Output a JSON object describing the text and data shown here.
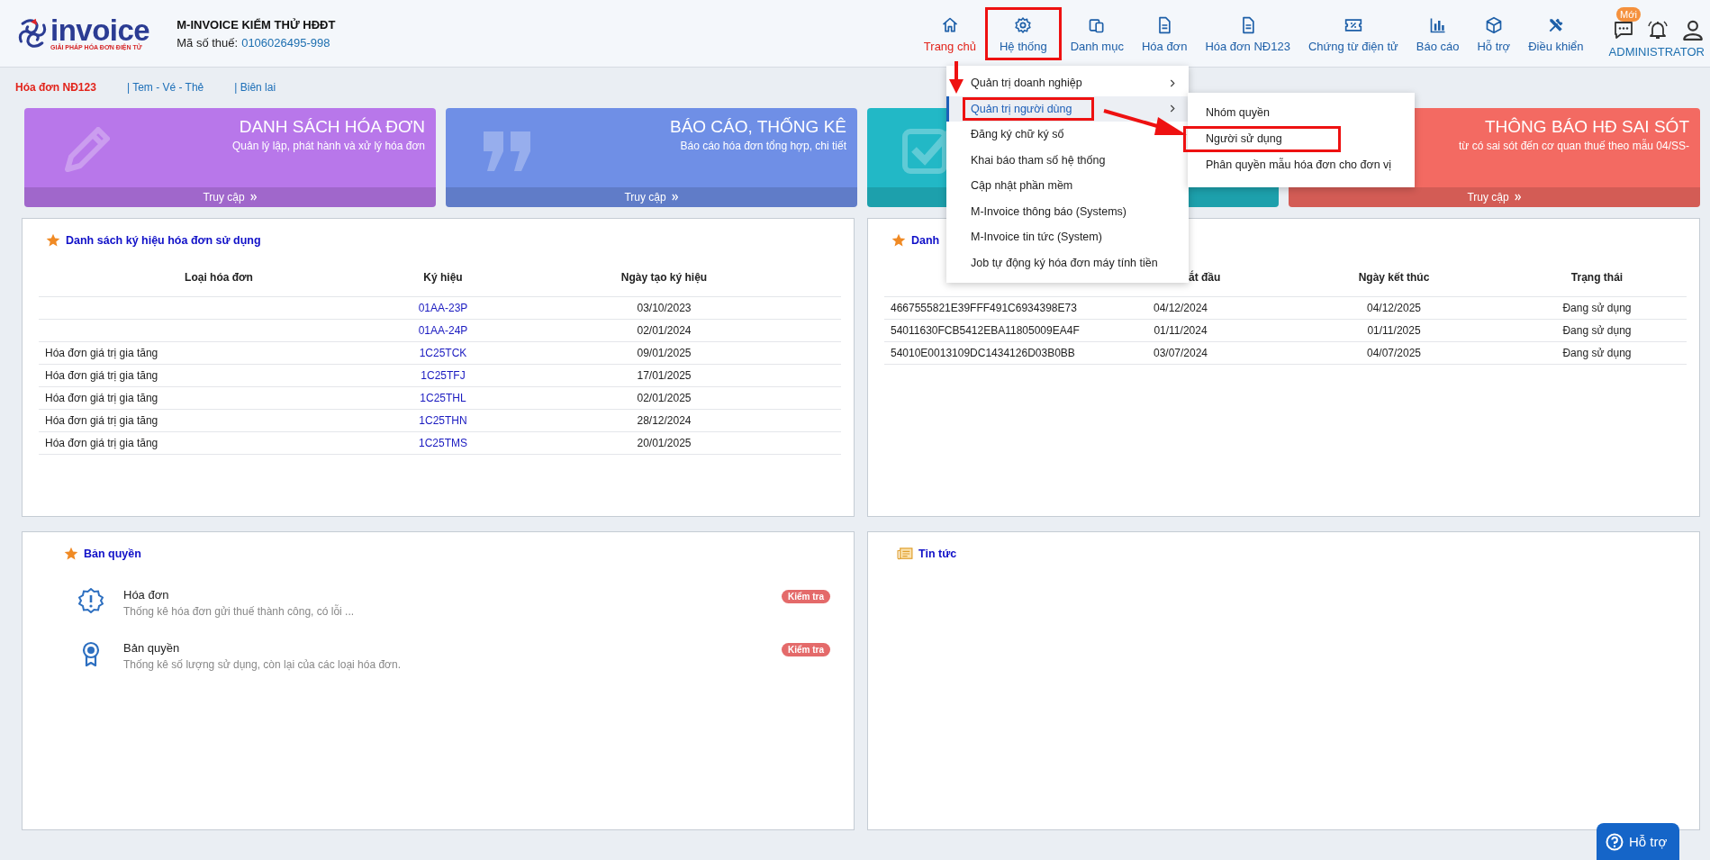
{
  "header": {
    "logo_text": "invoice",
    "logo_tagline": "GIẢI PHÁP HÓA ĐƠN ĐIỆN TỬ",
    "company": "M-INVOICE KIỂM THỬ HĐĐT",
    "tax_label": "Mã số thuế:",
    "tax_code": "0106026495-998"
  },
  "nav": [
    {
      "label": "Trang chủ",
      "selected": true,
      "annotated": false
    },
    {
      "label": "Hệ thống",
      "selected": false,
      "annotated": true
    },
    {
      "label": "Danh mục",
      "selected": false,
      "annotated": false
    },
    {
      "label": "Hóa đơn",
      "selected": false,
      "annotated": false
    },
    {
      "label": "Hóa đơn NĐ123",
      "selected": false,
      "annotated": false
    },
    {
      "label": "Chứng từ điện tử",
      "selected": false,
      "annotated": false
    },
    {
      "label": "Báo cáo",
      "selected": false,
      "annotated": false
    },
    {
      "label": "Hỗ trợ",
      "selected": false,
      "annotated": false
    },
    {
      "label": "Điều khiển",
      "selected": false,
      "annotated": false
    }
  ],
  "user": {
    "badge": "Mới",
    "name": "ADMINISTRATOR"
  },
  "sub_tabs": [
    {
      "label": "Hóa đơn NĐ123",
      "selected": true
    },
    {
      "label": "| Tem - Vé - Thẻ",
      "selected": false
    },
    {
      "label": "| Biên lai",
      "selected": false
    }
  ],
  "banners": [
    {
      "title": "DANH SÁCH HÓA ĐƠN",
      "subtitle": "Quản lý lập, phát hành và xử lý hóa đơn",
      "link": "Truy cập",
      "color": "#b877ea"
    },
    {
      "title": "BÁO CÁO, THỐNG KÊ",
      "subtitle": "Báo cáo hóa đơn tổng hợp, chi tiết",
      "link": "Truy cập",
      "color": "#6f8fe6"
    },
    {
      "color": "#22b8c6"
    },
    {
      "title": "THÔNG BÁO HĐ SAI SÓT",
      "subtitle": "từ có sai sót đến cơ quan thuế theo mẫu 04/SS-",
      "link": "Truy cập",
      "color": "#f36a62"
    }
  ],
  "symbol_panel": {
    "title": "Danh sách ký hiệu hóa đơn sử dụng",
    "columns": [
      "Loại hóa đơn",
      "Ký hiệu",
      "Ngày tạo ký hiệu"
    ],
    "rows": [
      {
        "symbol": "01AA-23P",
        "date": "03/10/2023"
      },
      {
        "symbol": "01AA-24P",
        "date": "02/01/2024"
      },
      {
        "type": "Hóa đơn giá trị gia tăng",
        "symbol": "1C25TCK",
        "date": "09/01/2025"
      },
      {
        "type": "Hóa đơn giá trị gia tăng",
        "symbol": "1C25TFJ",
        "date": "17/01/2025"
      },
      {
        "type": "Hóa đơn giá trị gia tăng",
        "symbol": "1C25THL",
        "date": "02/01/2025"
      },
      {
        "type": "Hóa đơn giá trị gia tăng",
        "symbol": "1C25THN",
        "date": "28/12/2024"
      },
      {
        "type": "Hóa đơn giá trị gia tăng",
        "symbol": "1C25TMS",
        "date": "20/01/2025"
      }
    ]
  },
  "cert_panel": {
    "title": "Danh",
    "columns": [
      "ắt đầu",
      "Ngày kết thúc",
      "Trạng thái"
    ],
    "rows": [
      {
        "serial": "4667555821E39FFF491C6934398E73",
        "start": "04/12/2024",
        "end": "04/12/2025",
        "status": "Đang sử dụng"
      },
      {
        "serial": "54011630FCB5412EBA11805009EA4F",
        "start": "01/11/2024",
        "end": "01/11/2025",
        "status": "Đang sử dụng"
      },
      {
        "serial": "54010E0013109DC1434126D03B0BB",
        "start": "03/07/2024",
        "end": "04/07/2025",
        "status": "Đang sử dụng"
      }
    ]
  },
  "license_panel": {
    "title": "Bản quyền",
    "items": [
      {
        "title": "Hóa đơn",
        "description": "Thống kê hóa đơn gửi thuế thành công, có lỗi ...",
        "action": "Kiểm tra"
      },
      {
        "title": "Bản quyền",
        "description": "Thống kê số lượng sử dụng, còn lại của các loại hóa đơn.",
        "action": "Kiểm tra"
      }
    ]
  },
  "news_panel": {
    "title": "Tin tức"
  },
  "menu": {
    "items": [
      {
        "label": "Quản trị doanh nghiệp",
        "has_submenu": true,
        "selected": false,
        "annotated": false
      },
      {
        "label": "Quản trị người dùng",
        "has_submenu": true,
        "selected": true,
        "annotated": true
      },
      {
        "label": "Đăng ký chữ ký số",
        "has_submenu": false,
        "selected": false,
        "annotated": false
      },
      {
        "label": "Khai báo tham số hệ thống",
        "has_submenu": false,
        "selected": false,
        "annotated": false
      },
      {
        "label": "Cập nhật phần mềm",
        "has_submenu": false,
        "selected": false,
        "annotated": false
      },
      {
        "label": "M-Invoice thông báo (Systems)",
        "has_submenu": false,
        "selected": false,
        "annotated": false
      },
      {
        "label": "M-Invoice tin tức (System)",
        "has_submenu": false,
        "selected": false,
        "annotated": false
      },
      {
        "label": "Job tự động ký hóa đơn máy tính tiền",
        "has_submenu": false,
        "selected": false,
        "annotated": false
      }
    ],
    "submenu": [
      {
        "label": "Nhóm quyền",
        "annotated": false
      },
      {
        "label": "Người sử dụng",
        "annotated": true
      },
      {
        "label": "Phân quyền mẫu hóa đơn cho đơn vị",
        "annotated": false
      }
    ]
  },
  "annotation_arrows": [
    {
      "kind": "down"
    },
    {
      "kind": "right"
    }
  ],
  "help_button": {
    "label": "Hỗ trợ"
  }
}
